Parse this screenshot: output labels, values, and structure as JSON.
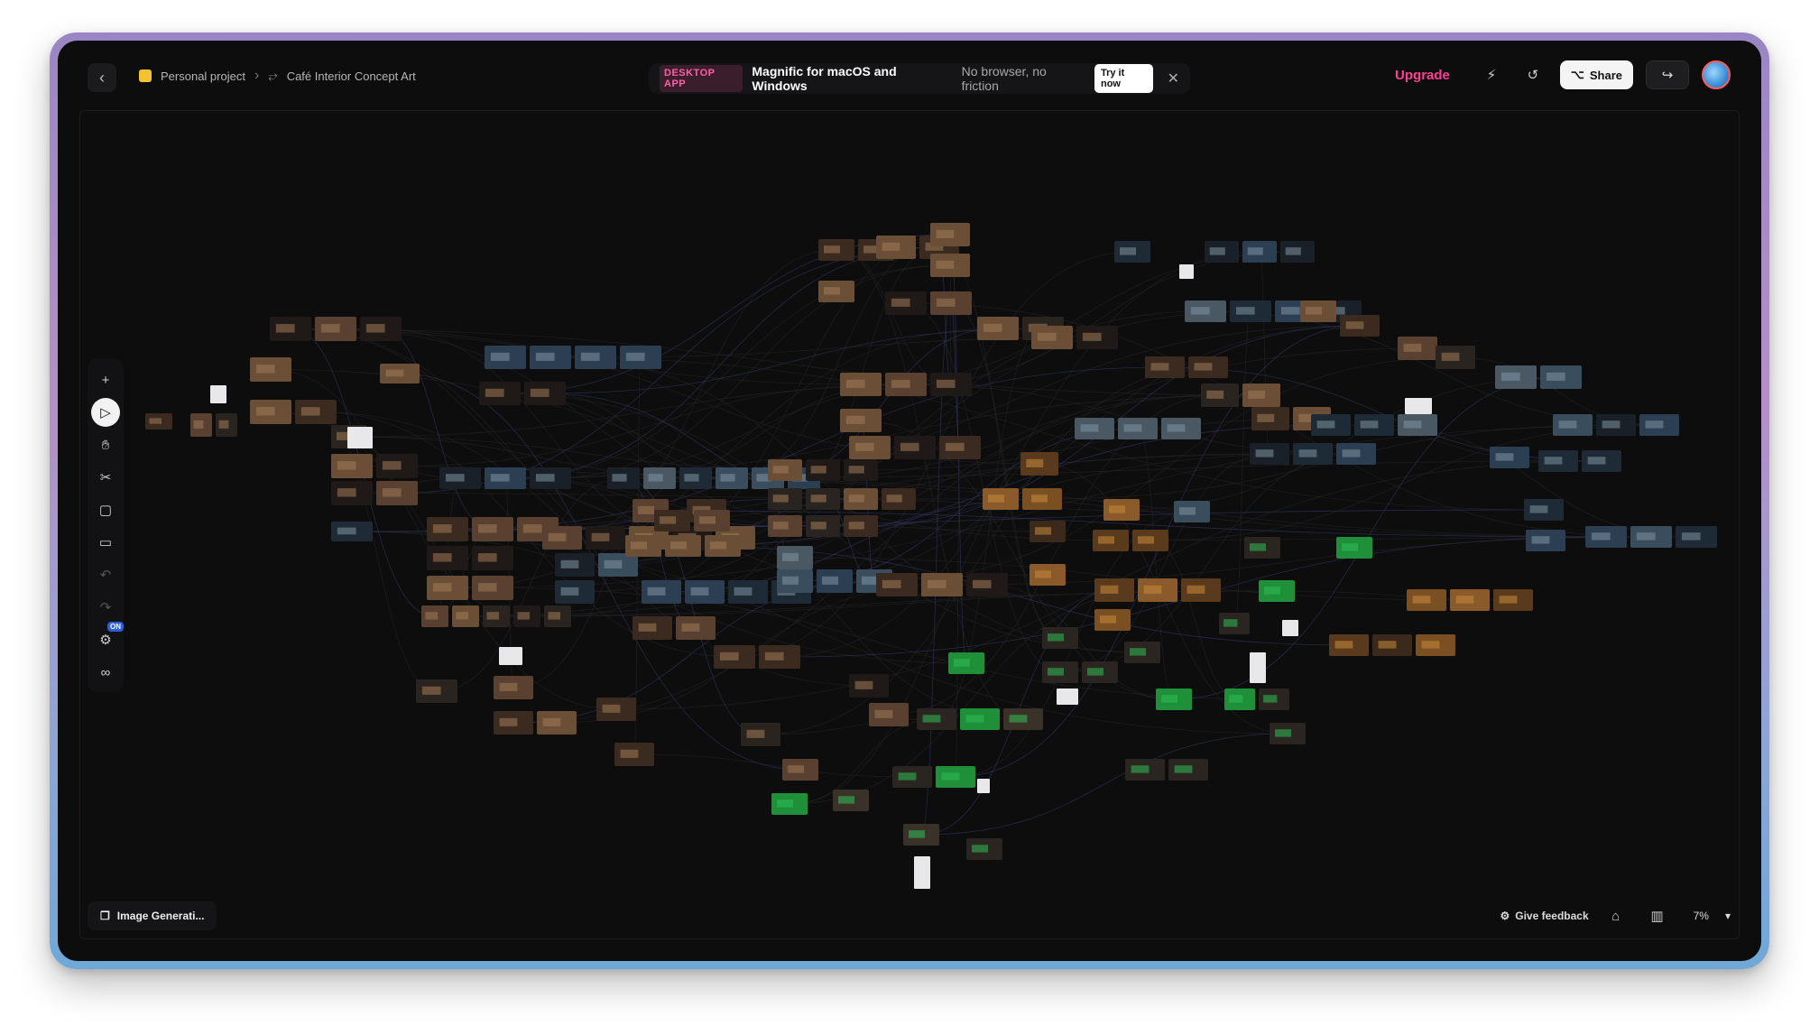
{
  "topbar": {
    "back_icon": "chevron-left-icon",
    "breadcrumb": {
      "project": "Personal project",
      "project_color": "#f2c230",
      "board": "Café Interior Concept Art"
    },
    "promo": {
      "badge": "DESKTOP APP",
      "title": "Magnific for macOS and Windows",
      "subtitle": "No browser, no friction",
      "cta": "Try it now"
    },
    "upgrade_label": "Upgrade",
    "upgrade_color": "#ff3d94",
    "share_label": "Share"
  },
  "toolbar": {
    "tools": [
      "plus-icon",
      "play-icon",
      "hand-icon",
      "scissors-icon",
      "frame-icon",
      "comment-icon",
      "undo-icon",
      "redo-icon",
      "settings-icon",
      "infinity-icon"
    ],
    "on_badge": "ON"
  },
  "bottom": {
    "node_label": "Image Generati...",
    "feedback_label": "Give feedback",
    "zoom_level": "7%"
  },
  "canvas": {
    "background": "#0d0d0e",
    "node_count_visible": "approx. 200 image nodes"
  }
}
